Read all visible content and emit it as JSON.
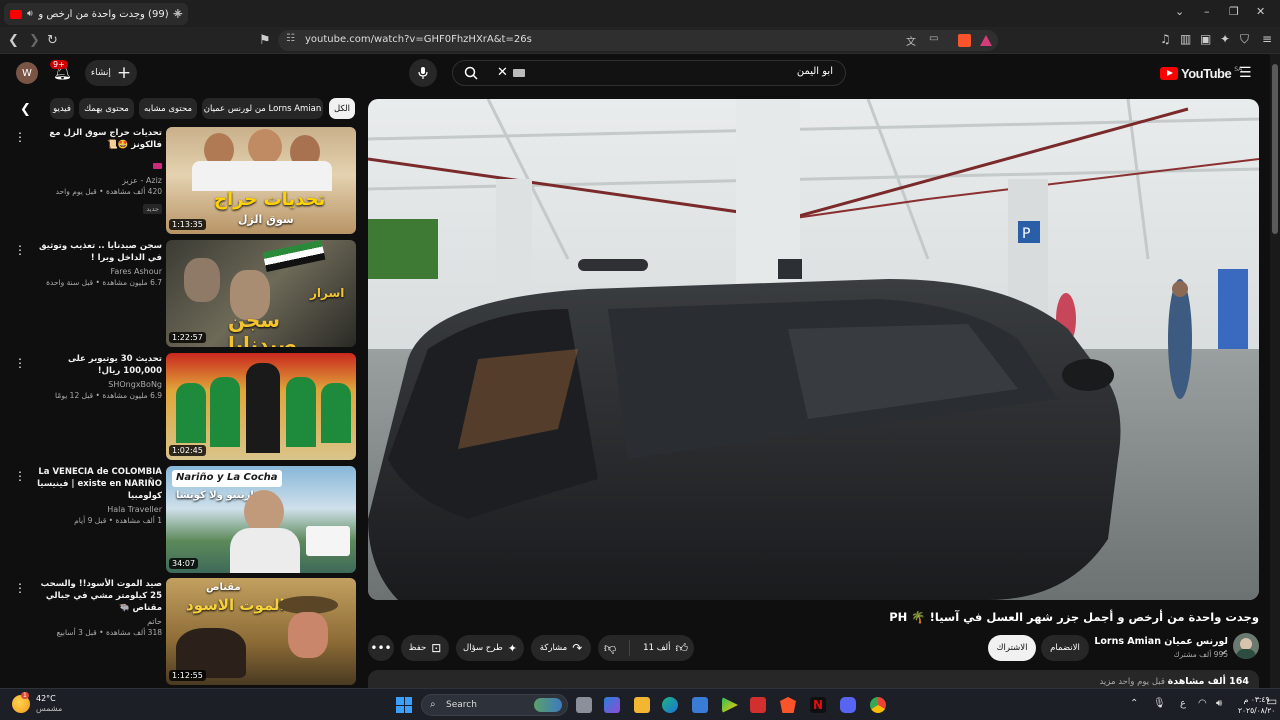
{
  "browser": {
    "tab_title": "(99) وجدت واحدة من أرخص و",
    "new_tab": "+",
    "url": "youtube.com/watch?v=GHF0FhzHXrA&t=26s",
    "window_controls": [
      "⌄",
      "–",
      "❐",
      "✕"
    ]
  },
  "header": {
    "avatar_letter": "W",
    "notif_count": "9+",
    "create_label": "إنشاء",
    "search_value": "ابو اليمن",
    "logo_text": "YouTube",
    "logo_region": "SA"
  },
  "chips": [
    {
      "label": "الكل",
      "active": true
    },
    {
      "label": "من لورنس عميان Lorns Amian",
      "active": false
    },
    {
      "label": "محتوى مشابه",
      "active": false
    },
    {
      "label": "محتوى يهمك",
      "active": false
    },
    {
      "label": "فيديو",
      "active": false
    }
  ],
  "recommended": [
    {
      "title": "تحديات حراج سوق الزل مع فالكونز 🤩📜",
      "channel": "Aziz - عزيز",
      "stats": "420 ألف مشاهدة • قبل يوم واحد",
      "badge": "جديد",
      "duration": "1:13:35",
      "thumb_text": "تحديات حراج",
      "thumb_sub": "سوق الزل"
    },
    {
      "title": "سجن صيدنايا .. تعذيب وتوثيق في الداخل وبرا !",
      "channel": "Fares Ashour",
      "stats": "6.7 مليون مشاهدة • قبل سنة واحدة",
      "badge": "",
      "duration": "1:22:57",
      "thumb_text": "سجن صيدنايا",
      "thumb_sub": "اسرار"
    },
    {
      "title": "تحديث 30 يوتيوبر على 100,000 ريال!",
      "channel": "SHOngxBoNg",
      "stats": "6.9 مليون مشاهدة • قبل 12 يومًا",
      "badge": "",
      "duration": "1:02:45",
      "thumb_text": "",
      "thumb_sub": ""
    },
    {
      "title": "La VENECIA de COLOMBIA existe en NARIÑO | فينيسيا كولومبيا",
      "channel": "Hala Traveller",
      "stats": "1 ألف مشاهدة • قبل 9 أيام",
      "badge": "",
      "duration": "34:07",
      "thumb_text": "Nariño y La Cocha",
      "thumb_sub": "نارينيو ولا كوتشا"
    },
    {
      "title": "صيد الموت الأسود!! والسحب 25 كيلومتر مشي في جبالي مقناص 🐃",
      "channel": "حاتم",
      "stats": "318 ألف مشاهدة • قبل 3 أسابيع",
      "badge": "",
      "duration": "1:12:55",
      "thumb_text": "مقناص",
      "thumb_sub": "الموت الاسود"
    }
  ],
  "video": {
    "title": "وجدت واحدة من أرخص و أجمل جزر شهر العسل في آسيا! 🌴 PH",
    "channel_name": "لورنس عميان Lorns Amian",
    "subscribers": "995 ألف مشترك",
    "join_label": "الانضمام",
    "subscribe_label": "الاشتراك",
    "likes": "11 ألف",
    "share_label": "مشاركة",
    "ask_label": "طرح سؤال",
    "save_label": "حفظ",
    "views": "164 ألف مشاهدة",
    "posted": "قبل يوم واحد",
    "more": "مزيد"
  },
  "taskbar": {
    "temperature": "42°C",
    "weather_desc": "مشمس",
    "weather_badge": "1",
    "search_label": "Search",
    "time": "٠٣:٤٩ م",
    "date": "٢٠٢٥/٠٨/٢٠",
    "lang": "ع"
  }
}
